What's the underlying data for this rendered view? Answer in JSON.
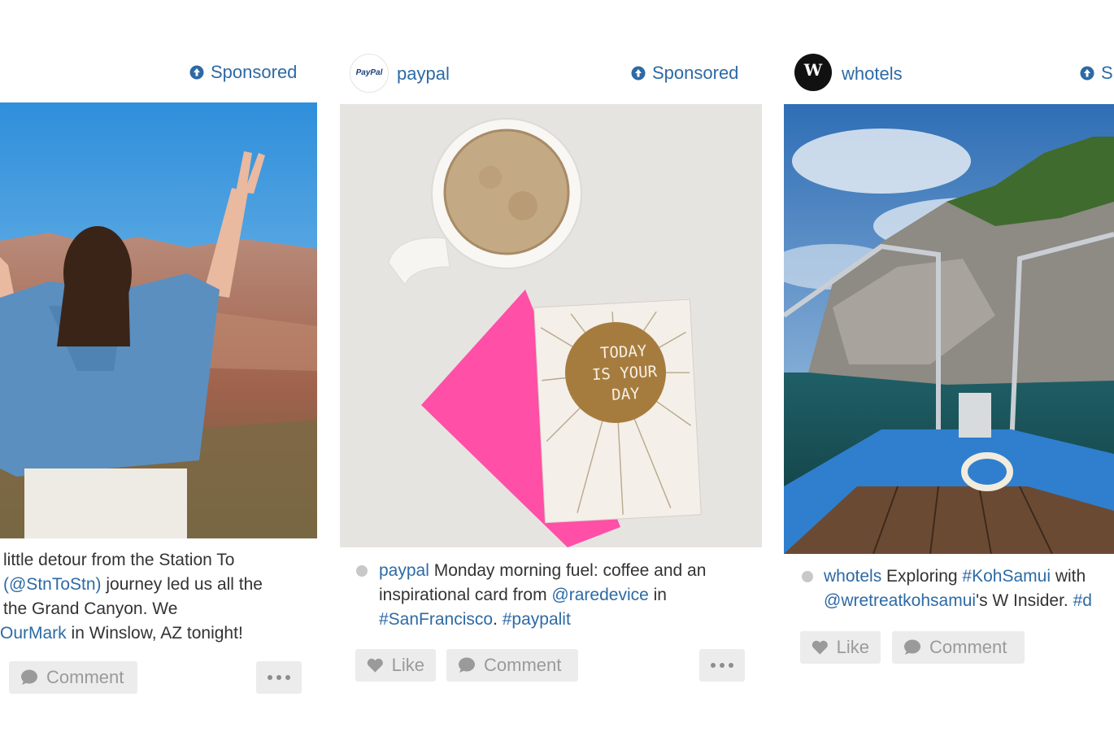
{
  "colors": {
    "link": "#2d6aa5",
    "button_bg": "#ececec",
    "button_text": "#9a9a9a"
  },
  "posts": [
    {
      "handle": "",
      "sponsored_label": "Sponsored",
      "caption": {
        "line1": "little detour from the Station To",
        "line2_link": "(@StnToStn)",
        "line2_rest": " journey led us all the",
        "line3": "the Grand Canyon. We",
        "line4_link": "OurMark",
        "line4_rest": " in Winslow, AZ tonight!"
      },
      "actions": {
        "comment": "Comment"
      }
    },
    {
      "handle": "paypal",
      "avatar_text": "PayPal",
      "sponsored_label": "Sponsored",
      "caption": {
        "user": "paypal",
        "text1": " Monday morning fuel: coffee and an",
        "text2": "inspirational card from ",
        "mention": "@raredevice",
        "text3": " in",
        "tag1": "#SanFrancisco",
        "sep": ". ",
        "tag2": "#paypalit"
      },
      "card_text": [
        "TODAY",
        "IS YOUR",
        "DAY"
      ],
      "actions": {
        "like": "Like",
        "comment": "Comment"
      }
    },
    {
      "handle": "whotels",
      "avatar_text": "W",
      "sponsored_label": "S",
      "caption": {
        "user": "whotels",
        "text1": " Exploring ",
        "tag1": "#KohSamui",
        "text2": " with",
        "mention": "@wretreatkohsamui",
        "text3": "'s W Insider. ",
        "tag2": "#d"
      },
      "actions": {
        "like": "Like",
        "comment": "Comment"
      }
    }
  ]
}
